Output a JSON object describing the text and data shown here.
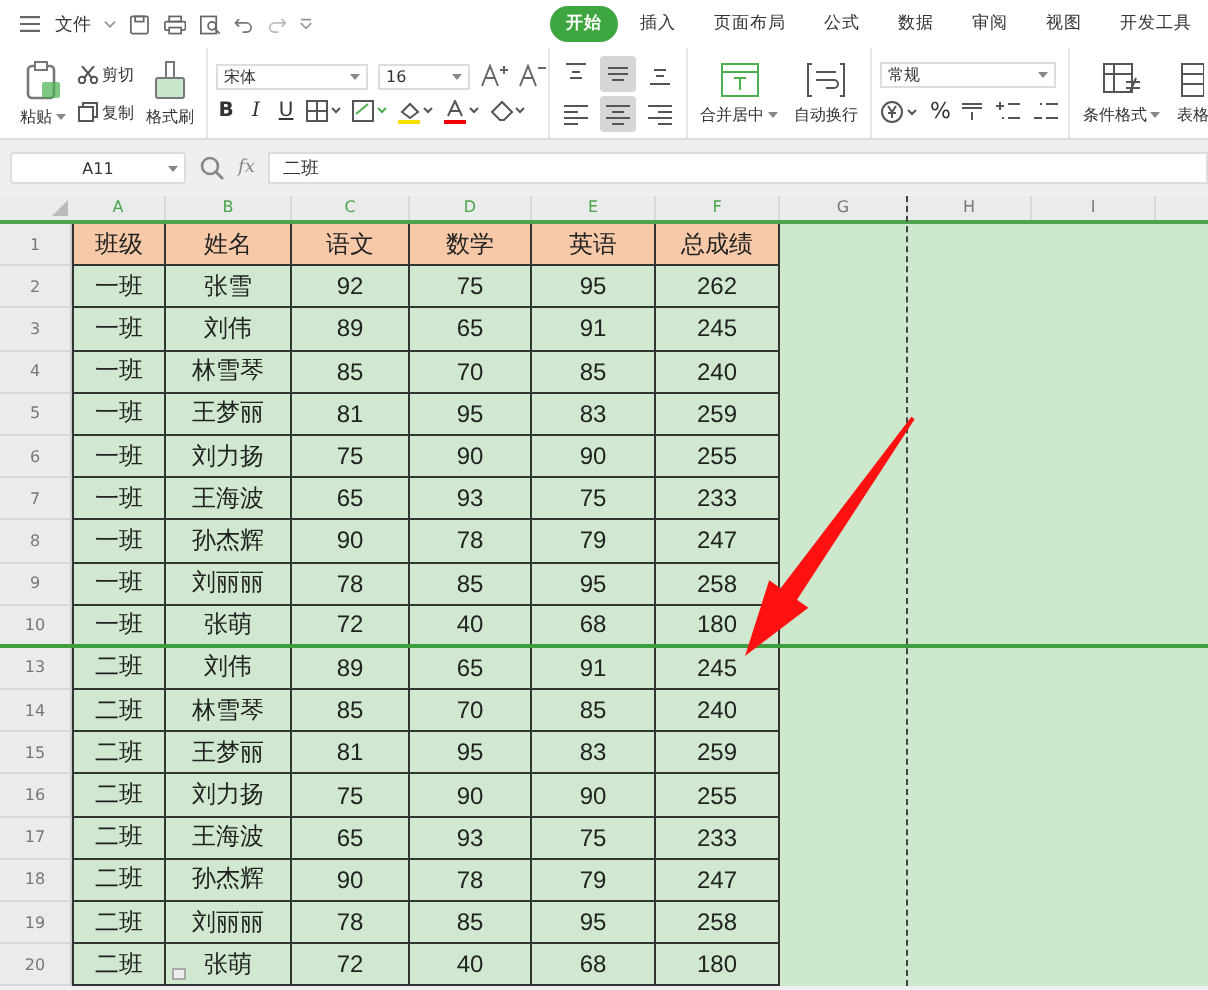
{
  "menu": {
    "file_label": "文件"
  },
  "tabs": [
    {
      "label": "开始",
      "selected": true
    },
    {
      "label": "插入",
      "selected": false
    },
    {
      "label": "页面布局",
      "selected": false
    },
    {
      "label": "公式",
      "selected": false
    },
    {
      "label": "数据",
      "selected": false
    },
    {
      "label": "审阅",
      "selected": false
    },
    {
      "label": "视图",
      "selected": false
    },
    {
      "label": "开发工具",
      "selected": false
    }
  ],
  "clipboard": {
    "paste": "粘贴",
    "cut": "剪切",
    "copy": "复制",
    "format_painter": "格式刷"
  },
  "font": {
    "name": "宋体",
    "size": "16",
    "style_buttons": [
      "B",
      "I",
      "U"
    ]
  },
  "alignment": [
    {
      "kind": "top",
      "selected": false
    },
    {
      "kind": "middle",
      "selected": true
    },
    {
      "kind": "bottom",
      "selected": false
    },
    {
      "kind": "left",
      "selected": false
    },
    {
      "kind": "center",
      "selected": true
    },
    {
      "kind": "right",
      "selected": false
    }
  ],
  "merge_label": "合并居中",
  "wrap_label": "自动换行",
  "number_format": "常规",
  "percent": "%",
  "conditional_label": "条件格式",
  "table_label": "表格",
  "formula_bar": {
    "cell_ref": "A11",
    "fx": "fx",
    "value": "二班"
  },
  "columns": [
    "A",
    "B",
    "C",
    "D",
    "E",
    "F",
    "G",
    "H",
    "I"
  ],
  "rows": [
    {
      "number": "1",
      "kind": "header",
      "cells": [
        "班级",
        "姓名",
        "语文",
        "数学",
        "英语",
        "总成绩"
      ]
    },
    {
      "number": "2",
      "kind": "data",
      "cells": [
        "一班",
        "张雪",
        "92",
        "75",
        "95",
        "262"
      ]
    },
    {
      "number": "3",
      "kind": "data",
      "cells": [
        "一班",
        "刘伟",
        "89",
        "65",
        "91",
        "245"
      ]
    },
    {
      "number": "4",
      "kind": "data",
      "cells": [
        "一班",
        "林雪琴",
        "85",
        "70",
        "85",
        "240"
      ]
    },
    {
      "number": "5",
      "kind": "data",
      "cells": [
        "一班",
        "王梦丽",
        "81",
        "95",
        "83",
        "259"
      ]
    },
    {
      "number": "6",
      "kind": "data",
      "cells": [
        "一班",
        "刘力扬",
        "75",
        "90",
        "90",
        "255"
      ]
    },
    {
      "number": "7",
      "kind": "data",
      "cells": [
        "一班",
        "王海波",
        "65",
        "93",
        "75",
        "233"
      ]
    },
    {
      "number": "8",
      "kind": "data",
      "cells": [
        "一班",
        "孙杰辉",
        "90",
        "78",
        "79",
        "247"
      ]
    },
    {
      "number": "9",
      "kind": "data",
      "cells": [
        "一班",
        "刘丽丽",
        "78",
        "85",
        "95",
        "258"
      ]
    },
    {
      "number": "10",
      "kind": "data",
      "cells": [
        "一班",
        "张萌",
        "72",
        "40",
        "68",
        "180"
      ]
    },
    {
      "number": "13",
      "kind": "data",
      "cells": [
        "二班",
        "刘伟",
        "89",
        "65",
        "91",
        "245"
      ]
    },
    {
      "number": "14",
      "kind": "data",
      "cells": [
        "二班",
        "林雪琴",
        "85",
        "70",
        "85",
        "240"
      ]
    },
    {
      "number": "15",
      "kind": "data",
      "cells": [
        "二班",
        "王梦丽",
        "81",
        "95",
        "83",
        "259"
      ]
    },
    {
      "number": "16",
      "kind": "data",
      "cells": [
        "二班",
        "刘力扬",
        "75",
        "90",
        "90",
        "255"
      ]
    },
    {
      "number": "17",
      "kind": "data",
      "cells": [
        "二班",
        "王海波",
        "65",
        "93",
        "75",
        "233"
      ]
    },
    {
      "number": "18",
      "kind": "data",
      "cells": [
        "二班",
        "孙杰辉",
        "90",
        "78",
        "79",
        "247"
      ]
    },
    {
      "number": "19",
      "kind": "data",
      "cells": [
        "二班",
        "刘丽丽",
        "78",
        "85",
        "95",
        "258"
      ]
    },
    {
      "number": "20",
      "kind": "data",
      "cells": [
        "二班",
        "张萌",
        "72",
        "40",
        "68",
        "180"
      ]
    }
  ]
}
